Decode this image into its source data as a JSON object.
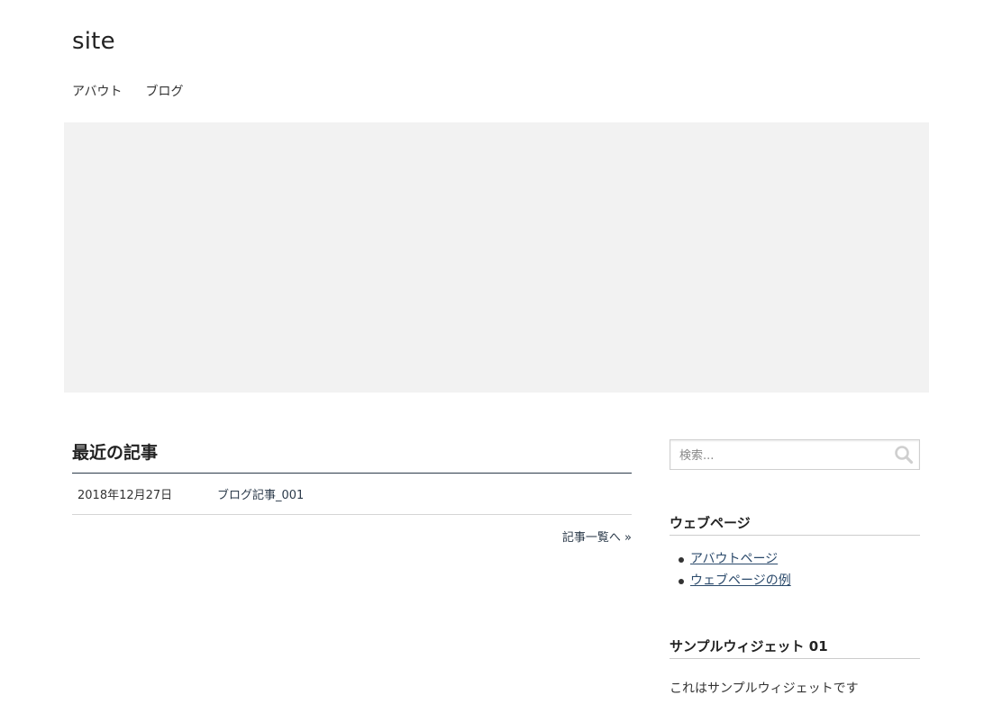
{
  "header": {
    "site_title": "site",
    "nav": [
      {
        "label": "アバウト"
      },
      {
        "label": "ブログ"
      }
    ]
  },
  "recent_posts": {
    "title": "最近の記事",
    "posts": [
      {
        "date": "2018年12月27日",
        "title": "ブログ記事_001"
      }
    ],
    "more_link": "記事一覧へ »"
  },
  "sidebar": {
    "search": {
      "placeholder": "検索...",
      "icon": "search-icon"
    },
    "pages_widget": {
      "title": "ウェブページ",
      "items": [
        {
          "label": "アバウトページ"
        },
        {
          "label": "ウェブページの例"
        }
      ]
    },
    "sample_widget": {
      "title": "サンプルウィジェット 01",
      "text": "これはサンプルウィジェットです"
    }
  },
  "colors": {
    "hero_background": "#f2f2f2",
    "link": "#2b4a6b",
    "section_rule": "#2b3a4a"
  }
}
